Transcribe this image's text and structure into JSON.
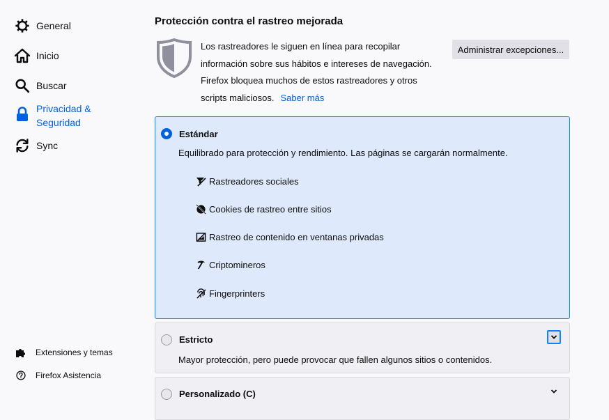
{
  "sidebar": {
    "items": [
      {
        "label": "General",
        "icon": "gear-icon"
      },
      {
        "label": "Inicio",
        "icon": "home-icon"
      },
      {
        "label": "Buscar",
        "icon": "search-icon"
      },
      {
        "label": "Privacidad &",
        "label2": "Seguridad",
        "icon": "lock-icon",
        "selected": true
      },
      {
        "label": "Sync",
        "icon": "sync-icon"
      }
    ],
    "footer": [
      {
        "label": "Extensiones y temas",
        "icon": "puzzle-icon"
      },
      {
        "label": "Firefox Asistencia",
        "icon": "help-icon"
      }
    ]
  },
  "section": {
    "title": "Protección contra el rastreo mejorada",
    "description_lines": [
      "Los rastreadores le siguen en línea para recopilar",
      "información sobre sus hábitos e intereses de navegación.",
      "Firefox bloquea muchos de estos rastreadores y otros",
      "scripts maliciosos."
    ],
    "learn_more": "Saber más",
    "exceptions_button": "Administrar excepciones..."
  },
  "options": {
    "standard": {
      "title": "Estándar",
      "description": "Equilibrado para protección y rendimiento. Las páginas se cargarán normalmente.",
      "selected": true,
      "categories": [
        {
          "label": "Rastreadores sociales",
          "icon": "social-tracker-icon"
        },
        {
          "label": "Cookies de rastreo entre sitios",
          "icon": "cookie-icon"
        },
        {
          "label": "Rastreo de contenido en ventanas privadas",
          "icon": "tracking-content-icon"
        },
        {
          "label": "Criptomineros",
          "icon": "cryptominer-icon"
        },
        {
          "label": "Fingerprinters",
          "icon": "fingerprint-icon"
        }
      ]
    },
    "strict": {
      "title": "Estricto",
      "description": "Mayor protección, pero puede provocar que fallen algunos sitios o contenidos.",
      "selected": false
    },
    "custom": {
      "title": "Personalizado (C)",
      "selected": false
    }
  },
  "colors": {
    "accent": "#0061e0",
    "selected_card_bg": "#deeafc",
    "selected_card_border": "#0a84ff"
  }
}
